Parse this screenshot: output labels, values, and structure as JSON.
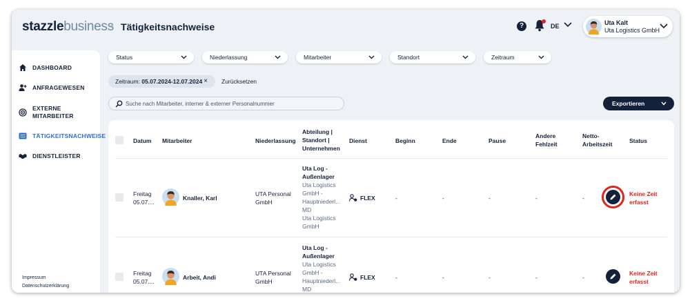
{
  "header": {
    "logo_bold": "stazzle",
    "logo_light": "business",
    "page_title": "Tätigkeitsnachweise",
    "help_label": "?",
    "language": "DE",
    "user": {
      "name": "Uta Kalt",
      "organization": "Uta Logistics GmbH"
    }
  },
  "sidebar": {
    "items": [
      {
        "label": "DASHBOARD",
        "icon": "home-icon",
        "active": false
      },
      {
        "label": "ANFRAGEWESEN",
        "icon": "add-person-icon",
        "active": false
      },
      {
        "label_line1": "EXTERNE",
        "label_line2": "MITARBEITER",
        "icon": "target-icon",
        "active": false
      },
      {
        "label": "TÄTIGKEITSNACHWEISE",
        "icon": "list-card-icon",
        "active": true
      },
      {
        "label": "DIENSTLEISTER",
        "icon": "handshake-icon",
        "active": false
      }
    ],
    "footer": {
      "impressum": "Impressum",
      "datenschutz": "Datenschutzerklärung"
    }
  },
  "filters": [
    {
      "label": "Status"
    },
    {
      "label": "Niederlassung"
    },
    {
      "label": "Mitarbeiter"
    },
    {
      "label": "Standort"
    },
    {
      "label": "Zeitraum"
    }
  ],
  "active_filter": {
    "prefix": "Zeitraum:",
    "value": "05.07.2024-12.07.2024",
    "remove": "×"
  },
  "reset_label": "Zurücksetzen",
  "search": {
    "placeholder": "Suche nach Mitarbeiter, interner & externer Personalnummer",
    "value": ""
  },
  "export_label": "Exportieren",
  "table": {
    "headers": {
      "datum": "Datum",
      "mitarbeiter": "Mitarbeiter",
      "niederlassung": "Niederlassung",
      "abteilung_1": "Abteilung |",
      "abteilung_2": "Standort |",
      "abteilung_3": "Unternehmen",
      "dienst": "Dienst",
      "beginn": "Beginn",
      "ende": "Ende",
      "pause": "Pause",
      "andere_1": "Andere",
      "andere_2": "Fehlzeit",
      "netto_1": "Netto-",
      "netto_2": "Arbeitszeit",
      "status": "Status"
    },
    "rows": [
      {
        "day": "Freitag",
        "date": "05.07....",
        "employee": "Knaller, Karl",
        "branch_1": "UTA Personal",
        "branch_2": "GmbH",
        "dept_1": "Uta Log -",
        "dept_2": "Außenlager",
        "loc_1": "Uta Logistics",
        "loc_2": "GmbH -",
        "loc_3": "Hauptniederl...",
        "loc_4": "MD",
        "company": "Uta Logistics",
        "company_2": "GmbH",
        "service": "FLEX",
        "begin": "-",
        "end": "-",
        "pause": "-",
        "other": "-",
        "net": "-",
        "status_1": "Keine Zeit",
        "status_2": "erfasst"
      },
      {
        "day": "Freitag",
        "date": "05.07....",
        "employee": "Arbeit, Andi",
        "branch_1": "UTA Personal",
        "branch_2": "GmbH",
        "dept_1": "Uta Log -",
        "dept_2": "Außenlager",
        "loc_1": "Uta Logistics",
        "loc_2": "GmbH -",
        "loc_3": "Hauptniederl...",
        "loc_4": "MD",
        "service": "FLEX",
        "begin": "-",
        "end": "-",
        "pause": "-",
        "other": "-",
        "net": "-",
        "status_1": "Keine Zeit",
        "status_2": "erfasst"
      }
    ]
  },
  "colors": {
    "navy": "#14213a",
    "accent_blue": "#2f6fd6",
    "alert_red": "#e2231a",
    "background": "#eef1f5"
  }
}
